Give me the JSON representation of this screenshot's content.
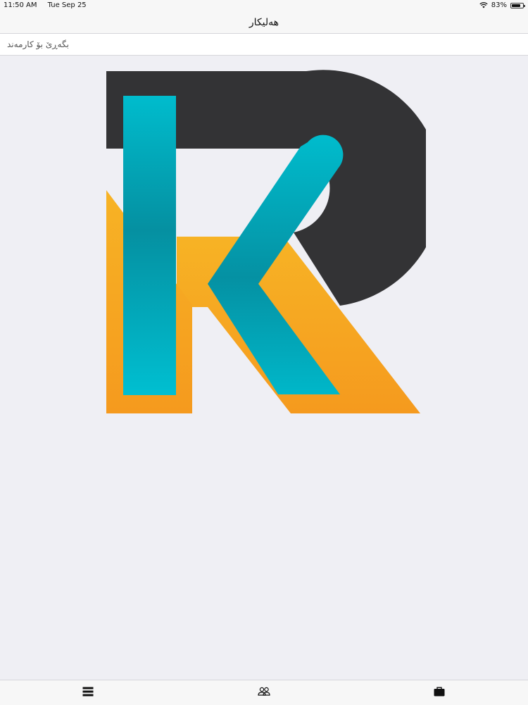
{
  "status_bar": {
    "time": "11:50 AM",
    "date": "Tue Sep 25",
    "battery_percent": "83%",
    "battery_level": 0.83,
    "icons": [
      "wifi-icon",
      "battery-icon"
    ]
  },
  "nav": {
    "title": "هەلیکار"
  },
  "search": {
    "placeholder": "بگەڕێ بۆ کارمەند",
    "value": ""
  },
  "logo": {
    "name": "logo-rk",
    "colors": {
      "dark": "#333335",
      "teal": "#00b5c8",
      "teal_dark": "#0591a3",
      "orange": "#f5a21e",
      "orange_light": "#f7b325"
    }
  },
  "tab_bar": {
    "tabs": [
      {
        "icon": "list-icon"
      },
      {
        "icon": "people-icon"
      },
      {
        "icon": "briefcase-icon"
      }
    ]
  },
  "colors": {
    "background": "#efeff4",
    "bars": "#f7f7f7",
    "separator": "#d6d6da"
  }
}
